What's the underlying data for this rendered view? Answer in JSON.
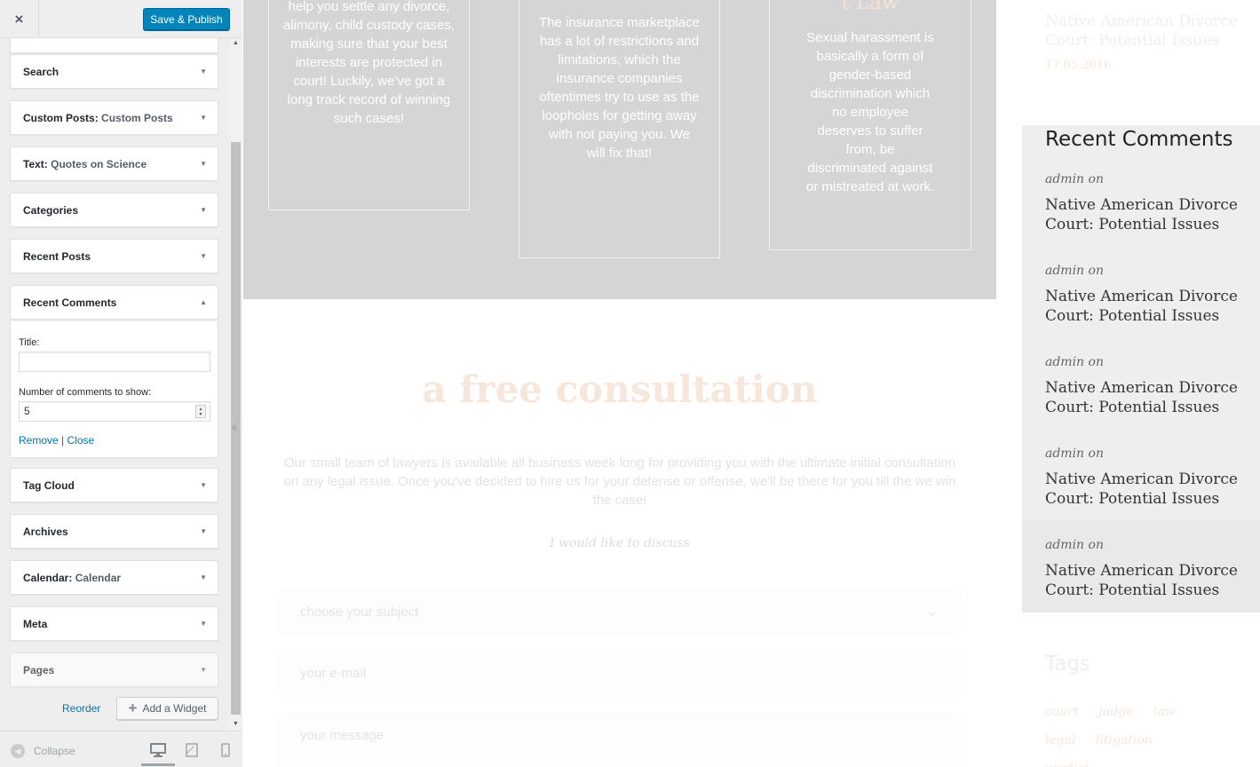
{
  "customizer": {
    "close_icon": "×",
    "save_label": "Save & Publish",
    "widgets": [
      {
        "name": "Search",
        "sub": ""
      },
      {
        "name": "Custom Posts",
        "sub": "Custom Posts"
      },
      {
        "name": "Text",
        "sub": "Quotes on Science"
      },
      {
        "name": "Categories",
        "sub": ""
      },
      {
        "name": "Recent Posts",
        "sub": ""
      },
      {
        "name": "Recent Comments",
        "sub": ""
      },
      {
        "name": "Tag Cloud",
        "sub": ""
      },
      {
        "name": "Archives",
        "sub": ""
      },
      {
        "name": "Calendar",
        "sub": "Calendar"
      },
      {
        "name": "Meta",
        "sub": ""
      },
      {
        "name": "Pages",
        "sub": ""
      }
    ],
    "recent_comments_form": {
      "title_label": "Title:",
      "title_value": "",
      "count_label": "Number of comments to show:",
      "count_value": "5",
      "remove_label": "Remove",
      "separator": "|",
      "close_label": "Close"
    },
    "reorder_label": "Reorder",
    "add_widget_label": "Add a Widget",
    "collapse_label": "Collapse",
    "devices": [
      "desktop-icon",
      "tablet-icon",
      "mobile-icon"
    ],
    "accent_color": "#0085ba"
  },
  "preview": {
    "cards": [
      {
        "title": "",
        "text": "help you settle any divorce, alimony, child custody cases, making sure that your best interests are protected in court! Luckily, we've got a long track record of winning such cases!"
      },
      {
        "title": "",
        "text": "The insurance marketplace has a lot of restrictions and limitations, which the insurance companies oftentimes try to use as the loopholes for getting away with not paying you. We will fix that!"
      },
      {
        "title": "t Law",
        "text": "Sexual harassment is basically a form of gender-based discrimination which no employee deserves to suffer from, be discriminated against or mistreated at work."
      }
    ],
    "consultation": {
      "heading": "a free consultation",
      "text": "Our small team of lawyers is available all business week long for providing you with the ultimate initial consultation on any legal issue. Once you've decided to hire us for your defense or offense, we'll be there for you till the we win the case!",
      "discuss": "I would like to discuss",
      "subject_placeholder": "choose your subject",
      "email_placeholder": "your e-mail",
      "message_placeholder": "your message"
    },
    "sidebar": {
      "recent_post_title": "Native American Divorce Court: Potential Issues",
      "recent_post_date": "17.05.2016",
      "recent_comments_heading": "Recent Comments",
      "comments": [
        {
          "author": "admin on",
          "link": "Native American Divorce Court: Potential Issues"
        },
        {
          "author": "admin on",
          "link": "Native American Divorce Court: Potential Issues"
        },
        {
          "author": "admin on",
          "link": "Native American Divorce Court: Potential Issues"
        },
        {
          "author": "admin on",
          "link": "Native American Divorce Court: Potential Issues"
        },
        {
          "author": "admin on",
          "link": "Native American Divorce Court: Potential Issues"
        }
      ],
      "tags_heading": "Tags",
      "tags": [
        "court",
        "judge",
        "law",
        "legal",
        "litigation",
        "verdict"
      ]
    }
  }
}
